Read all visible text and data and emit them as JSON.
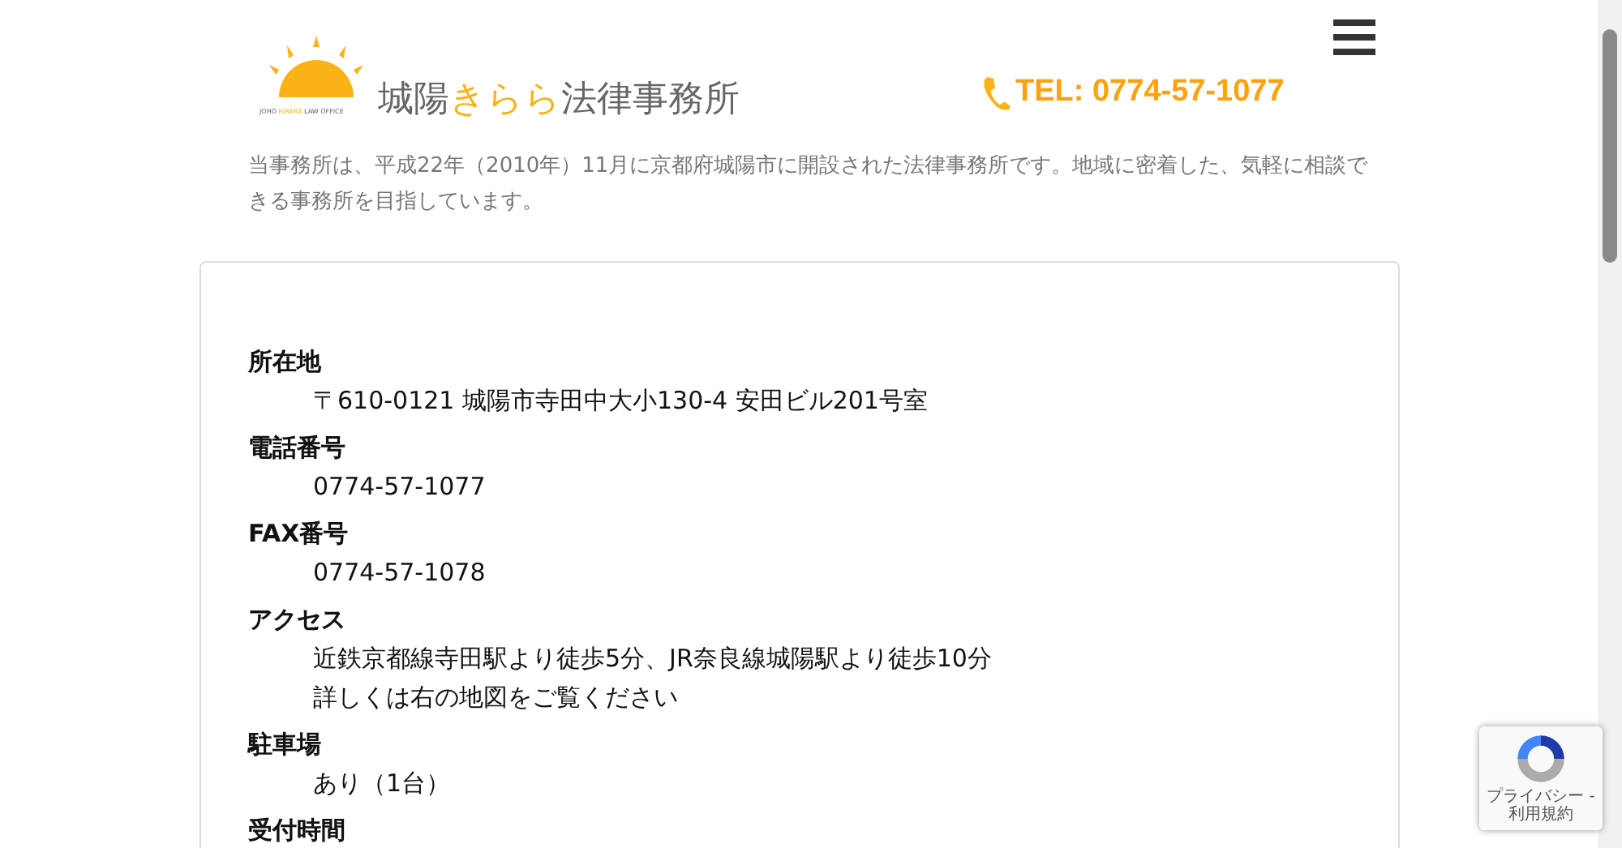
{
  "header": {
    "logo_tagline": [
      {
        "text": "JOHO ",
        "accent": false
      },
      {
        "text": "KIRARA",
        "accent": true
      },
      {
        "text": " LAW OFFICE",
        "accent": false
      }
    ],
    "logo_title": [
      {
        "text": "城陽",
        "accent": false
      },
      {
        "text": "きらら",
        "accent": true
      },
      {
        "text": "法律事務所",
        "accent": false
      }
    ],
    "tel": "TEL: 0774-57-1077"
  },
  "intro": "当事務所は、平成22年（2010年）11月に京都府城陽市に開設された法律事務所です。地域に密着した、気軽に相談できる事務所を目指しています。",
  "info": [
    {
      "term": "所在地",
      "lines": [
        "〒610-0121 城陽市寺田中大小130-4 安田ビル201号室"
      ]
    },
    {
      "term": "電話番号",
      "lines": [
        "0774-57-1077"
      ]
    },
    {
      "term": "FAX番号",
      "lines": [
        "0774-57-1078"
      ]
    },
    {
      "term": "アクセス",
      "lines": [
        "近鉄京都線寺田駅より徒歩5分、JR奈良線城陽駅より徒歩10分",
        "詳しくは右の地図をご覧ください"
      ]
    },
    {
      "term": "駐車場",
      "lines": [
        "あり（1台）"
      ]
    },
    {
      "term": "受付時間"
    }
  ],
  "recaptcha": {
    "links": "プライバシー - 利用規約"
  }
}
